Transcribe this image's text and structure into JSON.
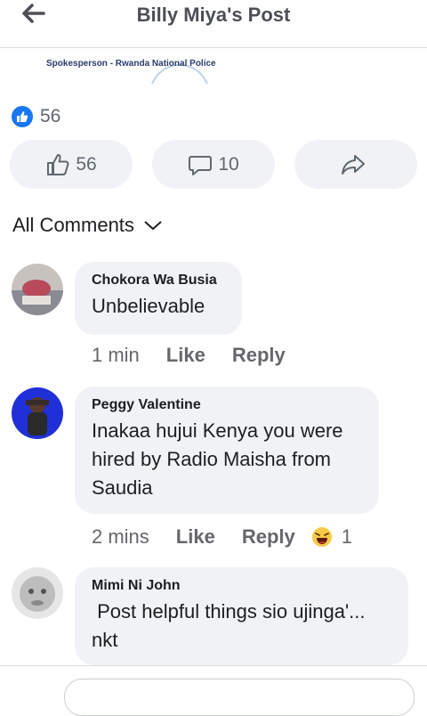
{
  "header": {
    "title": "Billy Miya's Post"
  },
  "post": {
    "caption": "Spokesperson - Rwanda National Police"
  },
  "reactions": {
    "count": "56"
  },
  "actions": {
    "like_count": "56",
    "comment_count": "10"
  },
  "comments_section": {
    "label": "All Comments"
  },
  "comments": [
    {
      "author": "Chokora Wa Busia",
      "text": "Unbelievable",
      "time": "1 min",
      "like": "Like",
      "reply": "Reply"
    },
    {
      "author": "Peggy Valentine",
      "text": "Inakaa hujui Kenya you were hired by Radio Maisha from Saudia",
      "time": "2 mins",
      "like": "Like",
      "reply": "Reply",
      "reaction_count": "1"
    },
    {
      "author": "Mimi Ni John",
      "text": " Post helpful things sio ujinga'... nkt"
    }
  ],
  "colors": {
    "accent": "#1877f2",
    "bubble": "#f0f2f5",
    "muted": "#65676b"
  }
}
